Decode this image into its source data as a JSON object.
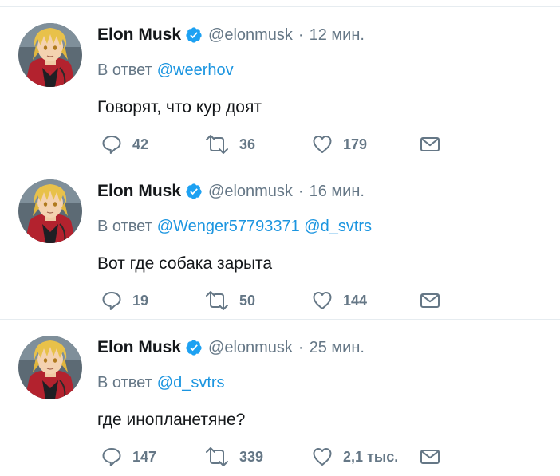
{
  "colors": {
    "text": "#14171a",
    "secondary": "#657786",
    "link": "#1b95e0",
    "verified": "#1da1f2",
    "divider": "#e6ecf0"
  },
  "icons": {
    "reply": "speech-bubble-icon",
    "retweet": "retweet-arrows-icon",
    "like": "heart-icon",
    "message": "envelope-icon",
    "verified": "verified-badge-icon"
  },
  "tweets": [
    {
      "name": "Elon Musk",
      "handle": "@elonmusk",
      "separator": "·",
      "time": "12 мин.",
      "reply_prefix": "В ответ",
      "reply_to": "@weerhov",
      "text": "Говорят, что кур доят",
      "replies": "42",
      "retweets": "36",
      "likes": "179"
    },
    {
      "name": "Elon Musk",
      "handle": "@elonmusk",
      "separator": "·",
      "time": "16 мин.",
      "reply_prefix": "В ответ",
      "reply_to": "@Wenger57793371 @d_svtrs",
      "text": "Вот где собака зарыта",
      "replies": "19",
      "retweets": "50",
      "likes": "144"
    },
    {
      "name": "Elon Musk",
      "handle": "@elonmusk",
      "separator": "·",
      "time": "25 мин.",
      "reply_prefix": "В ответ",
      "reply_to": "@d_svtrs",
      "text": "где инопланетяне?",
      "replies": "147",
      "retweets": "339",
      "likes": "2,1 тыс."
    }
  ]
}
